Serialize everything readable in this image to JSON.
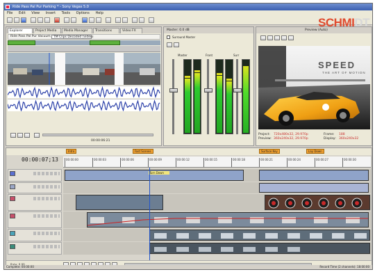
{
  "window": {
    "title": "Ride Pass Pal Pur Parking * - Sony Vegas 5.0"
  },
  "brand": {
    "part1": "SCHMI",
    "part2": "DT"
  },
  "menu": [
    "File",
    "Edit",
    "View",
    "Insert",
    "Tools",
    "Options",
    "Help"
  ],
  "explorer": {
    "tabs": [
      "Explorer",
      "Project Media",
      "Media Manager",
      "Transitions",
      "Video FX"
    ],
    "trim_file_label": "Ride Pass Pal Pur Vacuum",
    "trim_select": "TM Clips Decoded (video)"
  },
  "trimmer_timecode": "00:00:06:21",
  "mixer": {
    "title": "Master: 0.0 dB",
    "label": "Surround Master",
    "channel_labels": [
      "Master",
      "Front",
      "Surr"
    ]
  },
  "preview": {
    "title": "Preview (Auto)",
    "project_label": "Project:",
    "project_value": "720x480x32, 29.970p",
    "preview_label": "Preview:",
    "preview_value": "360x240x32, 29.970p",
    "frame_label": "Frame:",
    "frame_value": "188",
    "display_label": "Display:",
    "display_value": "360x240x32",
    "title_line1": "SPEED",
    "title_line2": "THE ART OF MOTION"
  },
  "timeline": {
    "timecode": "00:00:07;13",
    "markers": [
      "Intro",
      "Fast Scenes",
      "Surface Key",
      "Lay Down"
    ],
    "ruler_ticks": [
      "00:00:00",
      "00:00:03",
      "00:00:06",
      "00:00:09",
      "00:00:12",
      "00:00:15",
      "00:00:18",
      "00:00:21",
      "00:00:24",
      "00:00:27",
      "00:00:30"
    ],
    "region_label": "Turn Down",
    "rate_label": "Rate: 0.00"
  },
  "status": {
    "left": "Complete: 00:00:00",
    "right": "Record Time (2 channels): 18:00:00"
  },
  "colors": {
    "marker": "#f0a030",
    "cursor": "#2255cc",
    "meter": "#2ecc2e"
  }
}
